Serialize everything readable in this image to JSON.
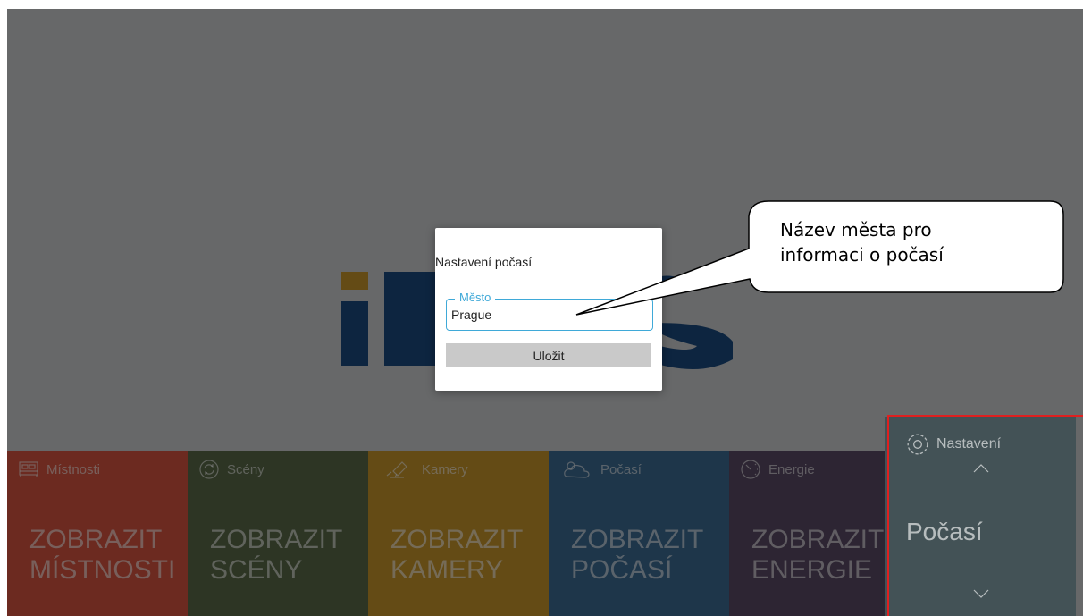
{
  "dialog": {
    "title": "Nastavení počasí",
    "field_label": "Město",
    "field_value": "Prague",
    "save_label": "Uložit"
  },
  "tiles": [
    {
      "label": "Místnosti",
      "action": "ZOBRAZIT MÍSTNOSTI",
      "icon": "bed-icon",
      "color": "#d85540"
    },
    {
      "label": "Scény",
      "action": "ZOBRAZIT SCÉNY",
      "icon": "refresh-circle-icon",
      "color": "#5a6b48"
    },
    {
      "label": "Kamery",
      "action": "ZOBRAZIT KAMERY",
      "icon": "camera-icon",
      "color": "#c9962b"
    },
    {
      "label": "Počasí",
      "action": "ZOBRAZIT POČASÍ",
      "icon": "cloud-sun-icon",
      "color": "#3d6d94"
    },
    {
      "label": "Energie",
      "action": "ZOBRAZIT ENERGIE",
      "icon": "gauge-icon",
      "color": "#5a4a66"
    }
  ],
  "settings_panel": {
    "title": "Nastavení",
    "value": "Počasí",
    "icon": "gear-icon",
    "color": "#86a4ac"
  },
  "callout": {
    "line1": "Název města pro",
    "line2": "informaci o počasí"
  },
  "colors": {
    "logo_gold": "#c9962b",
    "logo_blue": "#1a4b80",
    "accent": "#3fa9d8",
    "highlight_frame": "#e02020"
  }
}
